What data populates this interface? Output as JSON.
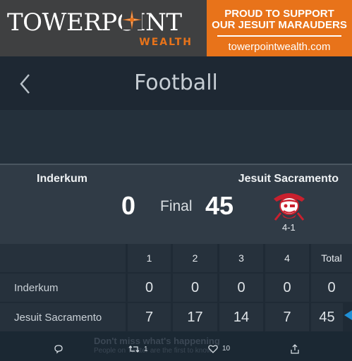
{
  "banner": {
    "logo_text": "TOWERPOINT",
    "logo_sub": "WEALTH",
    "promo_line1": "PROUD TO SUPPORT",
    "promo_line2": "OUR JESUIT MARAUDERS",
    "promo_url": "towerpointwealth.com",
    "colors": {
      "dark": "#3f4041",
      "orange": "#e8731a"
    }
  },
  "header": {
    "title": "Football",
    "back_icon": "chevron-left-icon"
  },
  "game": {
    "home_team": "Inderkum",
    "away_team": "Jesuit Sacramento",
    "home_score": "0",
    "away_score": "45",
    "status": "Final",
    "away_record": "4-1",
    "away_logo": "pirate-mascot-icon"
  },
  "linescore": {
    "headers": [
      "1",
      "2",
      "3",
      "4",
      "Total"
    ],
    "rows": [
      {
        "team": "Inderkum",
        "q": [
          "0",
          "0",
          "0",
          "0"
        ],
        "total": "0"
      },
      {
        "team": "Jesuit Sacramento",
        "q": [
          "7",
          "17",
          "14",
          "7"
        ],
        "total": "45"
      }
    ],
    "winner_marker_color": "#1f8fd6"
  },
  "tweet": {
    "headline": "Don't miss what's happening",
    "subline": "People on Twitter are the first to know.",
    "retweets": "1",
    "likes": "10",
    "icons": [
      "reply-icon",
      "retweet-icon",
      "like-icon",
      "share-icon"
    ]
  }
}
